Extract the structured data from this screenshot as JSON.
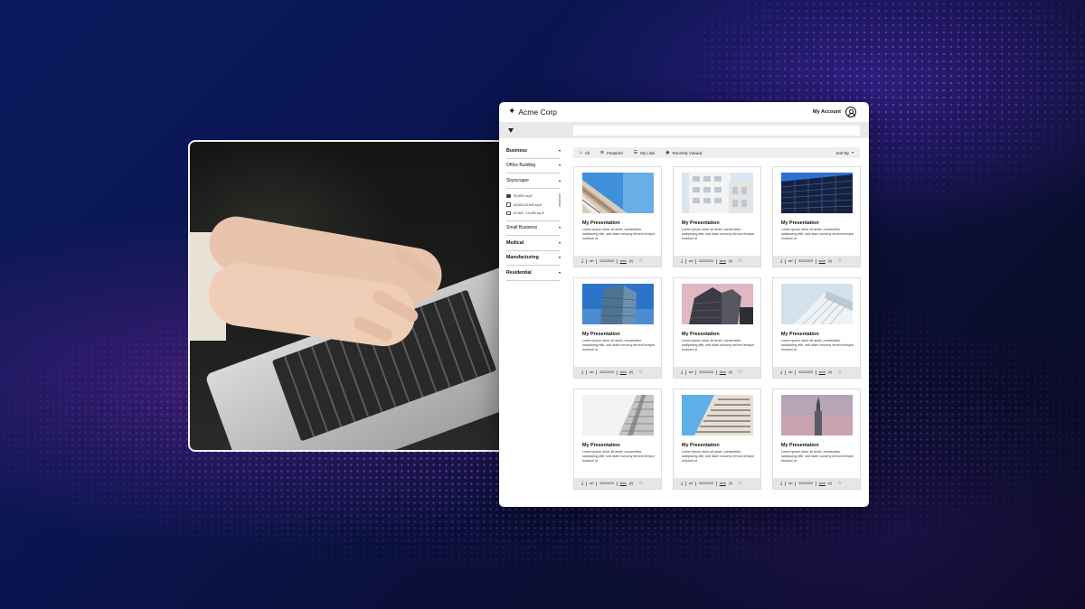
{
  "app": {
    "brand": "Acme Corp",
    "account_label": "My Account"
  },
  "search": {
    "placeholder": ""
  },
  "sidebar": {
    "categories": [
      {
        "label": "Business",
        "bold": true
      },
      {
        "label": "Office Building",
        "bold": false
      },
      {
        "label": "Skyscraper",
        "bold": false,
        "expanded": true
      },
      {
        "label": "Small Business",
        "bold": false
      },
      {
        "label": "Medical",
        "bold": true
      },
      {
        "label": "Manufacturing",
        "bold": true
      },
      {
        "label": "Residential",
        "bold": true
      }
    ],
    "skyscraper_options": [
      {
        "label": "20,000+ sq ft",
        "checked": true
      },
      {
        "label": "15,000-19,000 sq ft",
        "checked": false
      },
      {
        "label": "10,000 - 14,000 sq. ft",
        "checked": false
      }
    ]
  },
  "toolbar": {
    "all": "All",
    "featured": "Featured",
    "my_lists": "My Lists",
    "recently_viewed": "Recently Viewed",
    "sort_by": "Sort By"
  },
  "cards": [
    {
      "title": "My Presentation",
      "desc": "Lorem ipsum dolor sit amet, consectetur sadipscing elitr, sed diam nonumy eirmod tempor invidunt ut",
      "type": "sel",
      "date": "3/22/2023",
      "view": "view",
      "count": "(0)",
      "thumb": "b1"
    },
    {
      "title": "My Presentation",
      "desc": "Lorem ipsum dolor sit amet, consectetur sadipscing elitr, sed diam nonumy eirmod tempor invidunt ut",
      "type": "sel",
      "date": "3/22/2023",
      "view": "view",
      "count": "(0)",
      "thumb": "b2"
    },
    {
      "title": "My Presentation",
      "desc": "Lorem ipsum dolor sit amet, consectetur sadipscing elitr, sed diam nonumy eirmod tempor invidunt ut",
      "type": "sel",
      "date": "3/22/2023",
      "view": "view",
      "count": "(0)",
      "thumb": "b3"
    },
    {
      "title": "My Presentation",
      "desc": "Lorem ipsum dolor sit amet, consectetur sadipscing elitr, sed diam nonumy eirmod tempor invidunt ut",
      "type": "sel",
      "date": "3/22/2023",
      "view": "view",
      "count": "(0)",
      "thumb": "b4"
    },
    {
      "title": "My Presentation",
      "desc": "Lorem ipsum dolor sit amet, consectetur sadipscing elitr, sed diam nonumy eirmod tempor invidunt ut",
      "type": "sel",
      "date": "3/22/2023",
      "view": "view",
      "count": "(0)",
      "thumb": "b5"
    },
    {
      "title": "My Presentation",
      "desc": "Lorem ipsum dolor sit amet, consectetur sadipscing elitr, sed diam nonumy eirmod tempor invidunt ut",
      "type": "sel",
      "date": "3/22/2023",
      "view": "view",
      "count": "(0)",
      "thumb": "b6"
    },
    {
      "title": "My Presentation",
      "desc": "Lorem ipsum dolor sit amet, consectetur sadipscing elitr, sed diam nonumy eirmod tempor invidunt ut",
      "type": "sel",
      "date": "3/22/2023",
      "view": "view",
      "count": "(0)",
      "thumb": "b7"
    },
    {
      "title": "My Presentation",
      "desc": "Lorem ipsum dolor sit amet, consectetur sadipscing elitr, sed diam nonumy eirmod tempor invidunt ut",
      "type": "sel",
      "date": "3/22/2023",
      "view": "view",
      "count": "(0)",
      "thumb": "b8"
    },
    {
      "title": "My Presentation",
      "desc": "Lorem ipsum dolor sit amet, consectetur sadipscing elitr, sed diam nonumy eirmod tempor invidunt ut",
      "type": "sel",
      "date": "3/22/2023",
      "view": "view",
      "count": "(0)",
      "thumb": "b9"
    }
  ]
}
